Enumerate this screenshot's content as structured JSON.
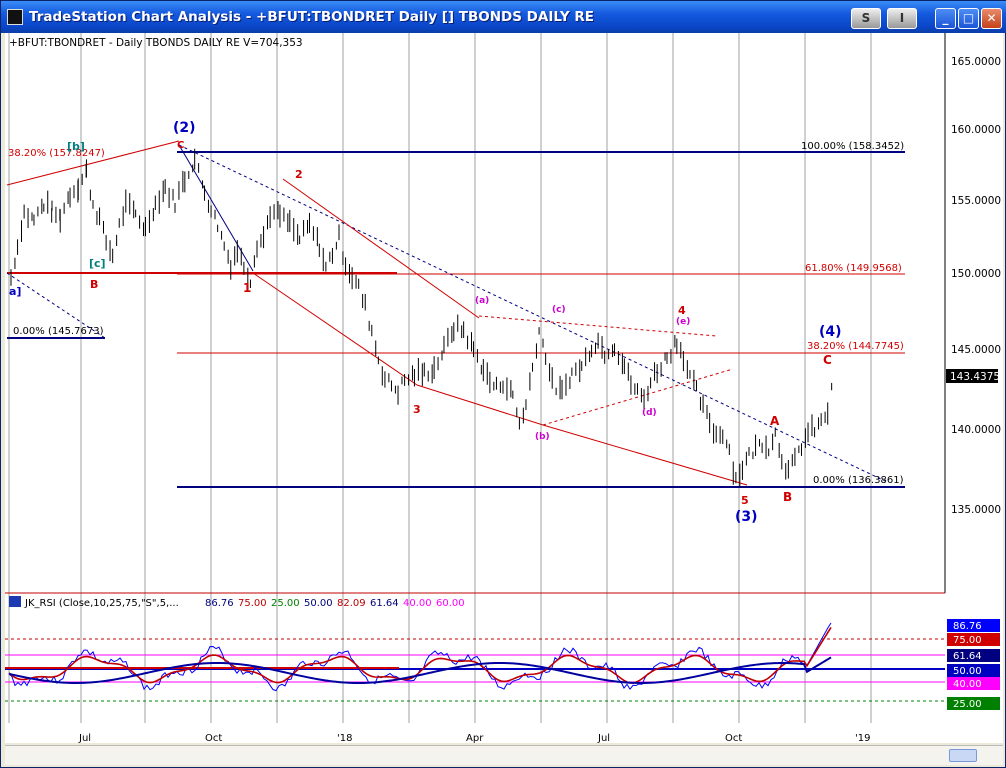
{
  "window": {
    "title": "TradeStation Chart Analysis - +BFUT:TBONDRET Daily [] TBONDS DAILY RE",
    "btn_s": "S",
    "btn_i": "I",
    "btn_min": "_",
    "btn_max": "□",
    "btn_close": "✕"
  },
  "chart_header": "+BFUT:TBONDRET - Daily  TBONDS DAILY RE  V=704,353",
  "price_axis": {
    "ticks": [
      "165.0000",
      "160.0000",
      "155.0000",
      "150.0000",
      "145.0000",
      "140.0000",
      "135.0000"
    ],
    "last_price": "143.4375",
    "last_price_color": "#000000"
  },
  "time_axis": {
    "ticks": [
      "Jul",
      "Oct",
      "'18",
      "Apr",
      "Jul",
      "Oct",
      "'19"
    ]
  },
  "annotations": {
    "w2": "(2)",
    "w3": "(3)",
    "w4": "(4)",
    "n1": "1",
    "n2": "2",
    "n3": "3",
    "n4": "4",
    "n5": "5",
    "a_small": "(a)",
    "b_small": "(b)",
    "c_small": "(c)",
    "d_small": "(d)",
    "e_small": "(e)",
    "big_A": "A",
    "big_B": "B",
    "big_C": "C",
    "left_B": "B",
    "left_C": "C",
    "bracket_b": "[b]",
    "bracket_c": "[c]",
    "a_bracket": "a]"
  },
  "levels": {
    "fib100": "100.00% (158.3452)",
    "fib618": "61.80% (149.9568)",
    "fib382": "38.20% (144.7745)",
    "fib0": "0.00% (136.3861)",
    "left382": "38.20% (157.8247)",
    "left0": "0.00% (145.7673)"
  },
  "rsi": {
    "legend": "JK_RSI (Close,10,25,75,\"S\",5,...",
    "vals": [
      "86.76",
      "75.00",
      "25.00",
      "50.00",
      "82.09",
      "61.64",
      "40.00",
      "60.00"
    ],
    "colors": [
      "#000080",
      "#c00000",
      "#008000",
      "#000080",
      "#c00000",
      "#000080",
      "#ff00ff",
      "#ff00ff"
    ],
    "badges": [
      {
        "label": "86.76",
        "color": "#0000ff"
      },
      {
        "label": "75.00",
        "color": "#d00000"
      },
      {
        "label": "61.64",
        "color": "#000080"
      },
      {
        "label": "50.00",
        "color": "#0000c0"
      },
      {
        "label": "40.00",
        "color": "#ff00ff"
      },
      {
        "label": "25.00",
        "color": "#008000"
      }
    ]
  },
  "price_series": {
    "note_hidden": "",
    "points": [
      [
        0,
        150.3
      ],
      [
        4,
        152.4
      ],
      [
        8,
        154.7
      ],
      [
        14,
        154.2
      ],
      [
        20,
        155.3
      ],
      [
        25,
        154.8
      ],
      [
        30,
        154.4
      ],
      [
        36,
        156.0
      ],
      [
        41,
        156.5
      ],
      [
        46,
        157.5
      ],
      [
        50,
        155.3
      ],
      [
        54,
        154.3
      ],
      [
        58,
        152.7
      ],
      [
        62,
        151.8
      ],
      [
        66,
        153.8
      ],
      [
        70,
        155.2
      ],
      [
        76,
        154.6
      ],
      [
        82,
        153.6
      ],
      [
        88,
        155.3
      ],
      [
        94,
        156.4
      ],
      [
        100,
        155.4
      ],
      [
        106,
        157.0
      ],
      [
        112,
        158.3
      ],
      [
        118,
        156.2
      ],
      [
        122,
        155.0
      ],
      [
        126,
        153.9
      ],
      [
        130,
        152.5
      ],
      [
        134,
        151.2
      ],
      [
        138,
        152.2
      ],
      [
        142,
        151.1
      ],
      [
        146,
        150.2
      ],
      [
        150,
        152.6
      ],
      [
        154,
        153.0
      ],
      [
        158,
        154.7
      ],
      [
        164,
        154.5
      ],
      [
        170,
        153.9
      ],
      [
        176,
        152.9
      ],
      [
        182,
        153.8
      ],
      [
        188,
        152.5
      ],
      [
        192,
        150.9
      ],
      [
        196,
        152.0
      ],
      [
        200,
        153.0
      ],
      [
        204,
        151.3
      ],
      [
        208,
        150.4
      ],
      [
        212,
        149.6
      ],
      [
        216,
        148.3
      ],
      [
        220,
        146.7
      ],
      [
        224,
        144.8
      ],
      [
        228,
        143.4
      ],
      [
        232,
        143.0
      ],
      [
        236,
        142.6
      ],
      [
        240,
        143.3
      ],
      [
        246,
        143.7
      ],
      [
        252,
        143.8
      ],
      [
        258,
        144.1
      ],
      [
        264,
        145.4
      ],
      [
        270,
        146.9
      ],
      [
        276,
        146.7
      ],
      [
        282,
        145.4
      ],
      [
        288,
        144.1
      ],
      [
        292,
        143.2
      ],
      [
        296,
        142.8
      ],
      [
        300,
        143.2
      ],
      [
        306,
        142.3
      ],
      [
        310,
        140.4
      ],
      [
        314,
        141.6
      ],
      [
        318,
        144.2
      ],
      [
        322,
        146.7
      ],
      [
        326,
        145.1
      ],
      [
        330,
        143.1
      ],
      [
        336,
        142.4
      ],
      [
        342,
        143.8
      ],
      [
        348,
        144.2
      ],
      [
        354,
        145.6
      ],
      [
        358,
        146.0
      ],
      [
        362,
        145.2
      ],
      [
        368,
        145.7
      ],
      [
        374,
        144.3
      ],
      [
        378,
        143.1
      ],
      [
        382,
        142.5
      ],
      [
        386,
        142.0
      ],
      [
        390,
        143.2
      ],
      [
        394,
        144.0
      ],
      [
        400,
        144.9
      ],
      [
        406,
        146.0
      ],
      [
        410,
        145.0
      ],
      [
        414,
        143.5
      ],
      [
        418,
        142.6
      ],
      [
        422,
        141.4
      ],
      [
        426,
        140.5
      ],
      [
        430,
        139.6
      ],
      [
        434,
        139.8
      ],
      [
        438,
        138.6
      ],
      [
        442,
        136.6
      ],
      [
        446,
        137.4
      ],
      [
        450,
        138.2
      ],
      [
        454,
        138.7
      ],
      [
        458,
        139.1
      ],
      [
        462,
        138.8
      ],
      [
        466,
        139.7
      ],
      [
        470,
        138.1
      ],
      [
        474,
        137.1
      ],
      [
        478,
        137.8
      ],
      [
        482,
        138.9
      ],
      [
        486,
        139.7
      ],
      [
        490,
        140.0
      ],
      [
        494,
        140.4
      ],
      [
        498,
        141.2
      ],
      [
        502,
        143.4
      ]
    ],
    "points_alt": []
  }
}
